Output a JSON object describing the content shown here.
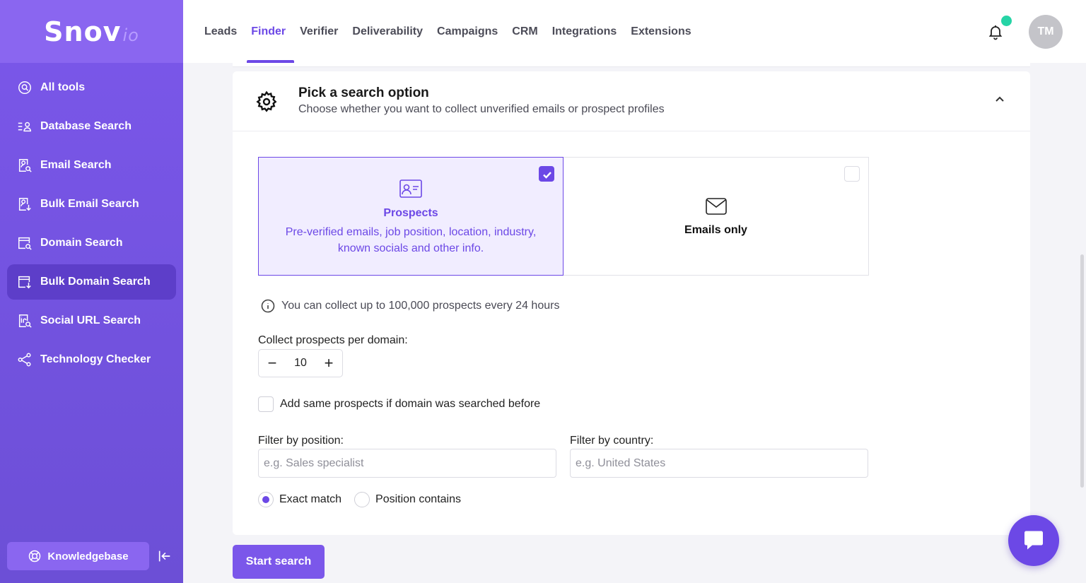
{
  "brand": {
    "name": "Snov",
    "suffix": "io"
  },
  "sidebar": {
    "items": [
      {
        "label": "All tools",
        "icon": "search-circle-icon"
      },
      {
        "label": "Database Search",
        "icon": "database-list-icon"
      },
      {
        "label": "Email Search",
        "icon": "email-search-icon"
      },
      {
        "label": "Bulk Email Search",
        "icon": "bulk-email-icon"
      },
      {
        "label": "Domain Search",
        "icon": "domain-search-icon"
      },
      {
        "label": "Bulk Domain Search",
        "icon": "bulk-domain-icon",
        "active": true
      },
      {
        "label": "Social URL Search",
        "icon": "social-url-icon"
      },
      {
        "label": "Technology Checker",
        "icon": "share-nodes-icon"
      }
    ],
    "knowledgebase_label": "Knowledgebase"
  },
  "topnav": {
    "items": [
      "Leads",
      "Finder",
      "Verifier",
      "Deliverability",
      "Campaigns",
      "CRM",
      "Integrations",
      "Extensions"
    ],
    "active": "Finder",
    "avatar_initials": "TM"
  },
  "section": {
    "title": "Pick a search option",
    "subtitle": "Choose whether you want to collect unverified emails or prospect profiles"
  },
  "options": {
    "prospects": {
      "title": "Prospects",
      "description": "Pre-verified emails, job position, location, industry, known socials and other info.",
      "checked": true
    },
    "emails": {
      "title": "Emails only",
      "checked": false
    }
  },
  "info_text": "You can collect up to 100,000 prospects every 24 hours",
  "per_domain": {
    "label": "Collect prospects per domain:",
    "value": "10"
  },
  "same_prospects_label": "Add same prospects if domain was searched before",
  "filters": {
    "position_label": "Filter by position:",
    "position_placeholder": "e.g. Sales specialist",
    "country_label": "Filter by country:",
    "country_placeholder": "e.g. United States"
  },
  "match": {
    "exact_label": "Exact match",
    "contains_label": "Position contains",
    "selected": "exact"
  },
  "start_button": "Start search",
  "colors": {
    "accent": "#6c48e6",
    "sidebar": "#7b57ea",
    "notification_dot": "#26d4a6"
  }
}
